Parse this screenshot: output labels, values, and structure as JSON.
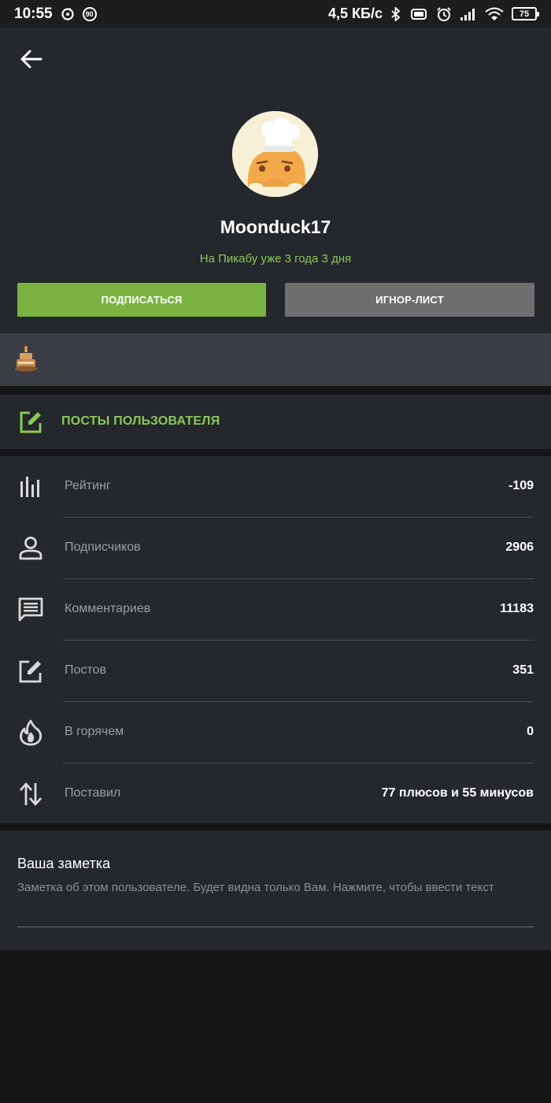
{
  "status_bar": {
    "time": "10:55",
    "badge_value": "90",
    "net_speed": "4,5 КБ/с",
    "battery_level": "75",
    "icons": [
      "sync-icon",
      "badge-icon",
      "bluetooth-icon",
      "vibrate-icon",
      "alarm-icon",
      "signal-icon",
      "wifi-icon",
      "battery-icon"
    ]
  },
  "header": {
    "back_icon": "arrow-left-icon",
    "username": "Moonduck17",
    "since": "На Пикабу уже 3 года 3 дня",
    "subscribe_label": "ПОДПИСАТЬСЯ",
    "ignore_label": "ИГНОР-ЛИСТ"
  },
  "awards": {
    "items": [
      "award-cake-icon"
    ]
  },
  "posts_link": {
    "icon": "edit-icon",
    "label": "ПОСТЫ ПОЛЬЗОВАТЕЛЯ"
  },
  "stats": [
    {
      "icon": "bar-chart-icon",
      "label": "Рейтинг",
      "value": "-109"
    },
    {
      "icon": "person-icon",
      "label": "Подписчиков",
      "value": "2906"
    },
    {
      "icon": "comment-icon",
      "label": "Комментариев",
      "value": "11183"
    },
    {
      "icon": "edit-icon",
      "label": "Постов",
      "value": "351"
    },
    {
      "icon": "fire-icon",
      "label": "В горячем",
      "value": "0"
    },
    {
      "icon": "sort-arrows-icon",
      "label": "Поставил",
      "value": "77 плюсов и 55 минусов"
    }
  ],
  "note": {
    "title": "Ваша заметка",
    "placeholder": "Заметка об этом пользователе. Будет видна только Вам. Нажмите, чтобы ввести текст"
  },
  "colors": {
    "accent_green": "#7ab342",
    "accent_text_green": "#8ac858",
    "panel": "#24272b",
    "ignore_button": "#6e6e6e",
    "background": "#151515"
  }
}
